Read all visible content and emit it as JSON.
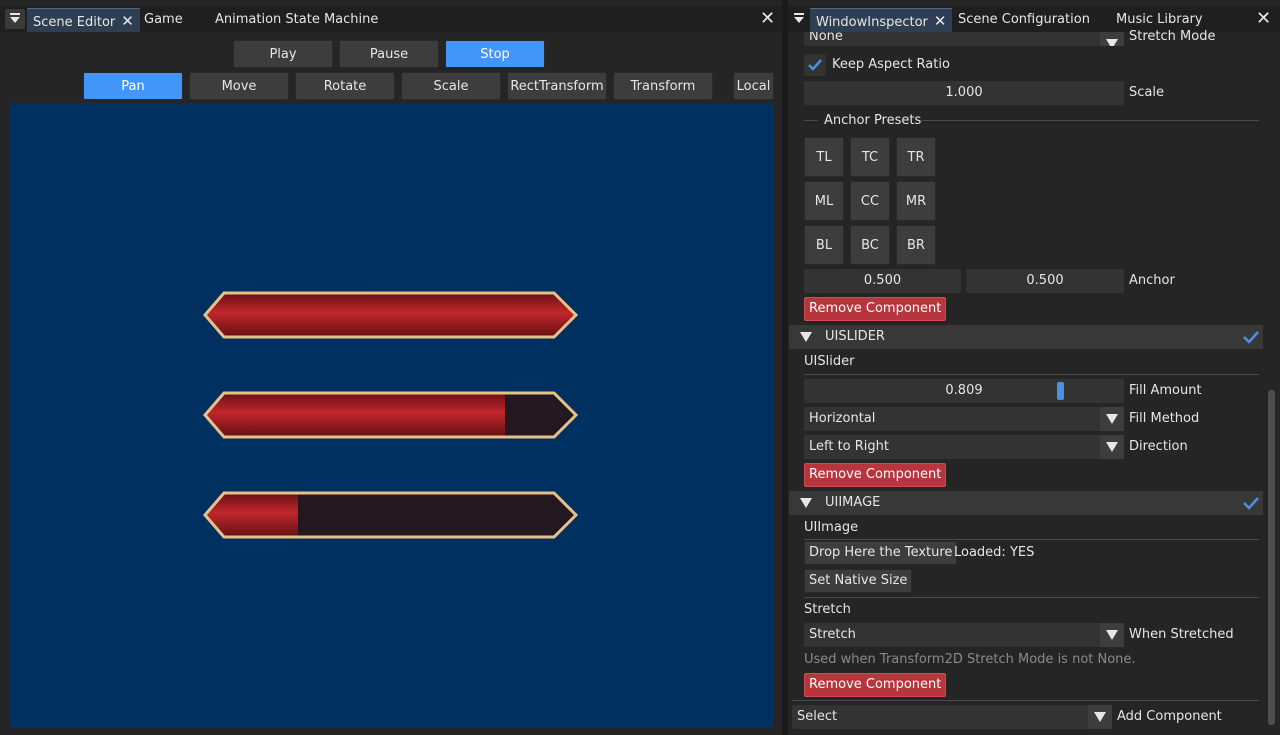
{
  "left_panel": {
    "tabs": [
      {
        "label": "Scene Editor",
        "closable": true
      },
      {
        "label": "Game"
      },
      {
        "label": "Animation State Machine"
      }
    ],
    "playback": {
      "play": "Play",
      "pause": "Pause",
      "stop": "Stop"
    },
    "tools": {
      "pan": "Pan",
      "move": "Move",
      "rotate": "Rotate",
      "scale": "Scale",
      "rect_transform": "RectTransform",
      "transform": "Transform",
      "local": "Local"
    },
    "active_tool": "Pan",
    "active_playback": "Stop",
    "viewport_color": "#00305f",
    "sliders": [
      {
        "fill": 1.0
      },
      {
        "fill": 0.809
      },
      {
        "fill": 0.25
      }
    ]
  },
  "right_panel": {
    "tabs": [
      {
        "label": "WindowInspector",
        "closable": true
      },
      {
        "label": "Scene Configuration"
      },
      {
        "label": "Music Library"
      }
    ],
    "stretch_mode": {
      "value": "None",
      "label": "Stretch Mode"
    },
    "keep_aspect": {
      "label": "Keep Aspect Ratio",
      "checked": true
    },
    "scale": {
      "value": "1.000",
      "label": "Scale"
    },
    "anchor_presets": {
      "title": "Anchor Presets",
      "buttons": [
        "TL",
        "TC",
        "TR",
        "ML",
        "CC",
        "MR",
        "BL",
        "BC",
        "BR"
      ]
    },
    "anchor": {
      "x": "0.500",
      "y": "0.500",
      "label": "Anchor"
    },
    "remove_component": "Remove Component",
    "uislider": {
      "header": "UISLIDER",
      "name": "UISlider",
      "fill_amount": {
        "value": "0.809",
        "fraction": 0.809,
        "label": "Fill Amount"
      },
      "fill_method": {
        "value": "Horizontal",
        "label": "Fill Method"
      },
      "direction": {
        "value": "Left to Right",
        "label": "Direction"
      }
    },
    "uiimage": {
      "header": "UIIMAGE",
      "name": "UIImage",
      "drop_texture": "Drop Here the Texture",
      "loaded": "Loaded: YES",
      "set_native": "Set Native Size",
      "stretch_title": "Stretch",
      "when_stretched": {
        "value": "Stretch",
        "label": "When Stretched"
      },
      "hint": "Used when Transform2D Stretch Mode is not None."
    },
    "add_component": {
      "value": "Select",
      "label": "Add Component"
    }
  },
  "colors": {
    "accent": "#4296fa",
    "danger": "#b7363d"
  }
}
